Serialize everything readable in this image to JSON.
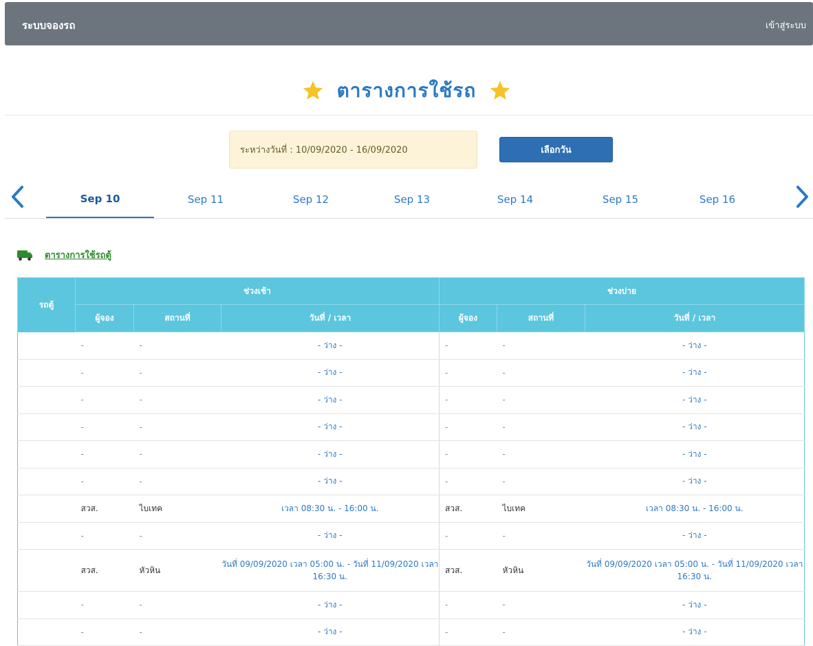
{
  "navbar": {
    "brand": "ระบบจองรถ",
    "login_label": "เข้าสู่ระบบ"
  },
  "page": {
    "title": "ตารางการใช้รถ",
    "star_color": "#f6c22a"
  },
  "date_range": {
    "text": "ระหว่างวันที่ : 10/09/2020 - 16/09/2020",
    "button_label": "เลือกวัน"
  },
  "tabs": [
    {
      "label": "Sep 10",
      "active": true
    },
    {
      "label": "Sep 11"
    },
    {
      "label": "Sep 12"
    },
    {
      "label": "Sep 13"
    },
    {
      "label": "Sep 14"
    },
    {
      "label": "Sep 15"
    },
    {
      "label": "Sep 16"
    }
  ],
  "section": {
    "title": "ตารางการใช้รถตู้",
    "icon": "van-icon"
  },
  "table": {
    "header": {
      "car": "รถตู้",
      "morning": "ช่วงเช้า",
      "afternoon": "ช่วงบ่าย",
      "booker": "ผู้จอง",
      "place": "สถานที่",
      "datetime": "วันที่ / เวลา"
    },
    "rows": [
      {
        "m_booker": "-",
        "m_place": "-",
        "m_time": "- ว่าง -",
        "a_booker": "-",
        "a_place": "-",
        "a_time": "- ว่าง -"
      },
      {
        "m_booker": "-",
        "m_place": "-",
        "m_time": "- ว่าง -",
        "a_booker": "-",
        "a_place": "-",
        "a_time": "- ว่าง -"
      },
      {
        "m_booker": "-",
        "m_place": "-",
        "m_time": "- ว่าง -",
        "a_booker": "-",
        "a_place": "-",
        "a_time": "- ว่าง -"
      },
      {
        "m_booker": "-",
        "m_place": "-",
        "m_time": "- ว่าง -",
        "a_booker": "-",
        "a_place": "-",
        "a_time": "- ว่าง -"
      },
      {
        "m_booker": "-",
        "m_place": "-",
        "m_time": "- ว่าง -",
        "a_booker": "-",
        "a_place": "-",
        "a_time": "- ว่าง -"
      },
      {
        "m_booker": "-",
        "m_place": "-",
        "m_time": "- ว่าง -",
        "a_booker": "-",
        "a_place": "-",
        "a_time": "- ว่าง -"
      },
      {
        "m_booker": "สวส.",
        "m_place": "ไบเทค",
        "m_time": "เวลา 08:30 น. - 16:00 น.",
        "a_booker": "สวส.",
        "a_place": "ไบเทค",
        "a_time": "เวลา 08:30 น. - 16:00 น."
      },
      {
        "m_booker": "-",
        "m_place": "-",
        "m_time": "- ว่าง -",
        "a_booker": "-",
        "a_place": "-",
        "a_time": "- ว่าง -"
      },
      {
        "m_booker": "สวส.",
        "m_place": "หัวหิน",
        "m_time": "วันที่ 09/09/2020 เวลา 05:00 น. - วันที่ 11/09/2020 เวลา 16:30 น.",
        "a_booker": "สวส.",
        "a_place": "หัวหิน",
        "a_time": "วันที่ 09/09/2020 เวลา 05:00 น. - วันที่ 11/09/2020 เวลา 16:30 น."
      },
      {
        "m_booker": "-",
        "m_place": "-",
        "m_time": "- ว่าง -",
        "a_booker": "-",
        "a_place": "-",
        "a_time": "- ว่าง -"
      },
      {
        "m_booker": "-",
        "m_place": "-",
        "m_time": "- ว่าง -",
        "a_booker": "-",
        "a_place": "-",
        "a_time": "- ว่าง -"
      }
    ]
  }
}
